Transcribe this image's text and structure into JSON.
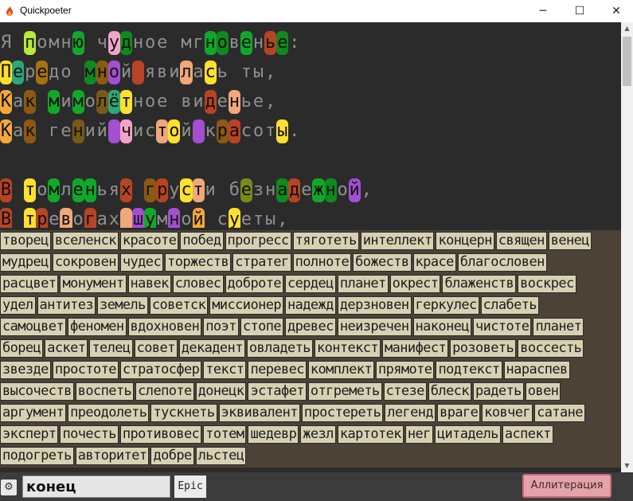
{
  "window": {
    "title": "Quickpoeter",
    "controls": {
      "minimize": "─",
      "maximize": "☐",
      "close": "✕"
    }
  },
  "poem": {
    "lines": [
      "Я помню чудное мгновенье:",
      "Передо мной явилась ты,",
      "Как мимолётное виденье,",
      "Как гений чистой красоты.",
      "",
      "В томленьях грусти безнадежной,",
      "В тревогах шумной суеты,"
    ],
    "highlights": [
      [
        [
          2,
          "#b9e83a"
        ],
        [
          6,
          "#11a82a"
        ],
        [
          9,
          "#f2a4c8"
        ],
        [
          10,
          "#0f8a20"
        ],
        [
          17,
          "#11a82a"
        ],
        [
          18,
          "#0f8a20"
        ],
        [
          20,
          "#11a82a"
        ],
        [
          22,
          "#b74424"
        ],
        [
          23,
          "#0f8a20"
        ]
      ],
      [
        [
          0,
          "#ffe02e"
        ],
        [
          1,
          "#2aa87a"
        ],
        [
          3,
          "#a8720e"
        ],
        [
          7,
          "#0f8a20"
        ],
        [
          8,
          "#8a5a12"
        ],
        [
          9,
          "#a34fd1"
        ],
        [
          11,
          "#b74424"
        ],
        [
          15,
          "#f0a77a"
        ],
        [
          17,
          "#ffe02e"
        ]
      ],
      [
        [
          0,
          "#f2a83a"
        ],
        [
          2,
          "#8a5a12"
        ],
        [
          4,
          "#11a82a"
        ],
        [
          6,
          "#11a82a"
        ],
        [
          8,
          "#7a5a1a"
        ],
        [
          9,
          "#2aa87a"
        ],
        [
          10,
          "#ffe02e"
        ],
        [
          17,
          "#b74424"
        ],
        [
          19,
          "#f0a77a"
        ]
      ],
      [
        [
          0,
          "#f2a83a"
        ],
        [
          2,
          "#8a5a12"
        ],
        [
          6,
          "#7a5a1a"
        ],
        [
          9,
          "#a34fd1"
        ],
        [
          10,
          "#f2a4c8"
        ],
        [
          13,
          "#f0a77a"
        ],
        [
          14,
          "#ffe02e"
        ],
        [
          16,
          "#a34fd1"
        ],
        [
          18,
          "#8a5a12"
        ],
        [
          19,
          "#b74424"
        ],
        [
          23,
          "#ffe02e"
        ]
      ],
      [],
      [
        [
          0,
          "#b74424"
        ],
        [
          2,
          "#ffe02e"
        ],
        [
          4,
          "#11a82a"
        ],
        [
          6,
          "#11a82a"
        ],
        [
          7,
          "#11a82a"
        ],
        [
          10,
          "#b74424"
        ],
        [
          12,
          "#8a5a12"
        ],
        [
          13,
          "#b74424"
        ],
        [
          15,
          "#ffe02e"
        ],
        [
          16,
          "#f0a77a"
        ],
        [
          20,
          "#7a8a1a"
        ],
        [
          23,
          "#0f8a20"
        ],
        [
          24,
          "#b74424"
        ],
        [
          26,
          "#11a82a"
        ],
        [
          27,
          "#0f8a20"
        ],
        [
          29,
          "#a34fd1"
        ]
      ],
      [
        [
          0,
          "#b74424"
        ],
        [
          2,
          "#ffe02e"
        ],
        [
          3,
          "#b74424"
        ],
        [
          5,
          "#f0a77a"
        ],
        [
          7,
          "#b74424"
        ],
        [
          10,
          "#f0a77a"
        ],
        [
          11,
          "#a34fd1"
        ],
        [
          12,
          "#11a82a"
        ],
        [
          14,
          "#a34fd1"
        ],
        [
          16,
          "#f2a83a"
        ],
        [
          19,
          "#ffe02e"
        ]
      ]
    ]
  },
  "words": {
    "rows": [
      [
        "творец",
        "вселенск",
        "красоте",
        "побед",
        "прогресс",
        "тяготеть",
        "интеллект",
        "концерн",
        "священ",
        "венец"
      ],
      [
        "мудрец",
        "сокровен",
        "чудес",
        "торжеств",
        "стратег",
        "полноте",
        "божеств",
        "красе",
        "благословен"
      ],
      [
        "расцвет",
        "монумент",
        "навек",
        "словес",
        "доброте",
        "сердец",
        "планет",
        "окрест",
        "блаженств",
        "воскрес"
      ],
      [
        "удел",
        "антитез",
        "земель",
        "советск",
        "миссионер",
        "надежд",
        "дерзновен",
        "геркулес",
        "слабеть"
      ],
      [
        "самоцвет",
        "феномен",
        "вдохновен",
        "поэт",
        "стопе",
        "древес",
        "неизречен",
        "наконец",
        "чистоте",
        "планет"
      ],
      [
        "борец",
        "аскет",
        "телец",
        "совет",
        "декадент",
        "овладеть",
        "контекст",
        "манифест",
        "розоветь",
        "воссесть"
      ],
      [
        "звезде",
        "простоте",
        "стратосфер",
        "текст",
        "перевес",
        "комплект",
        "прямоте",
        "подтекст",
        "нараспев"
      ],
      [
        "высочеств",
        "воспеть",
        "слепоте",
        "донецк",
        "эстафет",
        "отгреметь",
        "стезе",
        "блеск",
        "радеть",
        "овен"
      ],
      [
        "аргумент",
        "преодолеть",
        "тускнеть",
        "эквивалент",
        "простереть",
        "легенд",
        "враге",
        "ковчег",
        "сатане"
      ],
      [
        "эксперт",
        "почесть",
        "противовес",
        "тотем",
        "шедевр",
        "жезл",
        "картотек",
        "нег",
        "цитадель",
        "аспект"
      ],
      [
        "подогреть",
        "авторитет",
        "добре",
        "льстец"
      ]
    ]
  },
  "toolbar": {
    "settings_icon": "gear-icon",
    "settings_glyph": "⚙",
    "search_value": "конец",
    "style_label": "Epic",
    "mode_label": "Аллитерация"
  },
  "scrollbar": {
    "up": "▲",
    "down": "▼"
  },
  "colors": {
    "poem_background": "#2b2b2b",
    "words_background": "#4c4236",
    "word_chip": "#d7d1b3",
    "mode_button": "#e4a3aa"
  }
}
